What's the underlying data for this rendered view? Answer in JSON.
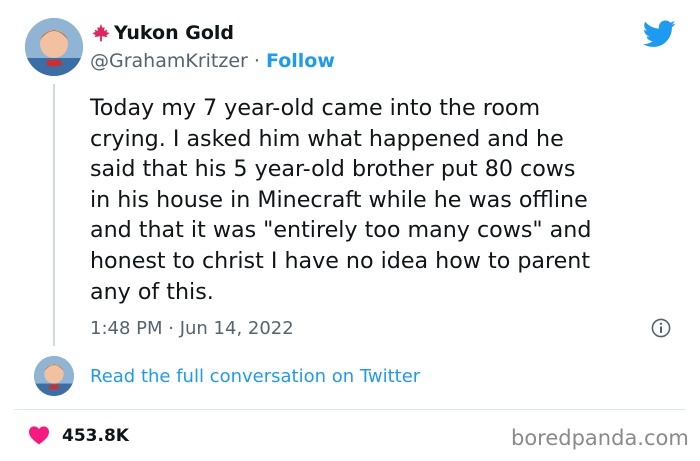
{
  "author": {
    "display_name": "Yukon Gold",
    "handle": "@GrahamKritzer",
    "separator": "·",
    "follow_label": "Follow"
  },
  "tweet": {
    "text": "Today my 7 year-old came into the room\ncrying. I asked him what happened and he\nsaid that his 5 year-old brother put 80 cows\nin his house in Minecraft while he was offline\nand that it was \"entirely too many cows\" and\nhonest to christ I have no idea how to parent\nany of this.",
    "timestamp": "1:48 PM · Jun 14, 2022"
  },
  "conversation": {
    "link_label": "Read the full conversation on Twitter"
  },
  "stats": {
    "likes": "453.8K"
  },
  "watermark": "boredpanda.com",
  "icons": {
    "brand": "twitter-bird-icon",
    "flag": "maple-leaf-icon",
    "info": "info-icon",
    "like": "heart-icon"
  },
  "colors": {
    "accent": "#1d9bf0",
    "like": "#f91880",
    "muted": "#536471",
    "maple": "#e0245e"
  }
}
